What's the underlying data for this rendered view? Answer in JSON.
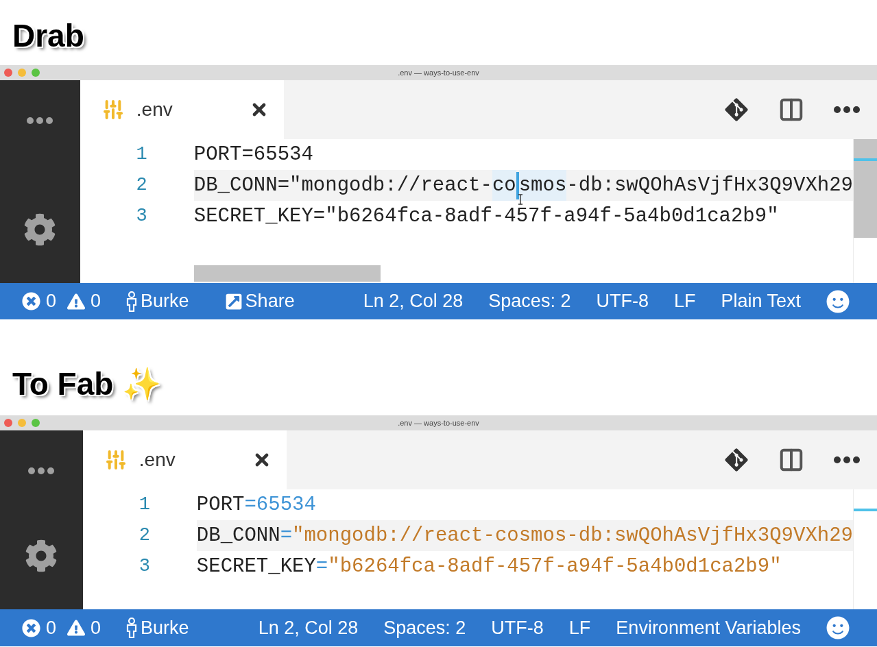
{
  "panels": [
    {
      "heading": "Drab",
      "window": {
        "title": ".env — ways-to-use-env"
      },
      "tab": {
        "label": ".env",
        "selected": true
      },
      "scrollbars_visible": true,
      "lines": [
        {
          "number": "1",
          "current": false,
          "tokens": [
            {
              "kind": "plain",
              "text": "PORT=65534"
            }
          ]
        },
        {
          "number": "2",
          "current": true,
          "tokens": [
            {
              "kind": "plain",
              "text": "DB_CONN=\"mongodb://react-"
            },
            {
              "kind": "match",
              "text": "co"
            },
            {
              "kind": "cursor"
            },
            {
              "kind": "match",
              "text": "smos"
            },
            {
              "kind": "plain",
              "text": "-db:swQOhAsVjfHx3Q9VXh29"
            }
          ]
        },
        {
          "number": "3",
          "current": false,
          "tokens": [
            {
              "kind": "plain",
              "text": "SECRET_KEY=\"b6264fca-8adf-457f-a94f-5a4b0d1ca2b9\""
            }
          ]
        }
      ],
      "status_bar": {
        "left": [
          {
            "kind": "errors",
            "text": "0"
          },
          {
            "kind": "warnings",
            "text": "0"
          },
          {
            "kind": "user",
            "text": "Burke"
          },
          {
            "kind": "share",
            "text": "Share"
          }
        ],
        "right": [
          {
            "kind": "text",
            "text": "Ln 2, Col 28"
          },
          {
            "kind": "text",
            "text": "Spaces: 2"
          },
          {
            "kind": "text",
            "text": "UTF-8"
          },
          {
            "kind": "text",
            "text": "LF"
          },
          {
            "kind": "text",
            "text": "Plain Text"
          },
          {
            "kind": "feedback"
          }
        ]
      }
    },
    {
      "heading": "To Fab ✨",
      "window": {
        "title": ".env — ways-to-use-env"
      },
      "tab": {
        "label": ".env",
        "selected": true
      },
      "scrollbars_visible": false,
      "lines": [
        {
          "number": "1",
          "current": false,
          "tokens": [
            {
              "kind": "key",
              "text": "PORT"
            },
            {
              "kind": "op",
              "text": "="
            },
            {
              "kind": "number",
              "text": "65534"
            }
          ]
        },
        {
          "number": "2",
          "current": true,
          "tokens": [
            {
              "kind": "key",
              "text": "DB_CONN"
            },
            {
              "kind": "op",
              "text": "="
            },
            {
              "kind": "string",
              "text": "\"mongodb://react-cosmos-db:swQOhAsVjfHx3Q9VXh29"
            }
          ]
        },
        {
          "number": "3",
          "current": false,
          "tokens": [
            {
              "kind": "key",
              "text": "SECRET_KEY"
            },
            {
              "kind": "op",
              "text": "="
            },
            {
              "kind": "string",
              "text": "\"b6264fca-8adf-457f-a94f-5a4b0d1ca2b9\""
            }
          ]
        }
      ],
      "status_bar": {
        "left": [
          {
            "kind": "errors",
            "text": "0"
          },
          {
            "kind": "warnings",
            "text": "0"
          },
          {
            "kind": "user",
            "text": "Burke"
          }
        ],
        "right": [
          {
            "kind": "text",
            "text": "Ln 2, Col 28"
          },
          {
            "kind": "text",
            "text": "Spaces: 2"
          },
          {
            "kind": "text",
            "text": "UTF-8"
          },
          {
            "kind": "text",
            "text": "LF"
          },
          {
            "kind": "text",
            "text": "Environment Variables"
          },
          {
            "kind": "feedback"
          }
        ]
      }
    }
  ]
}
